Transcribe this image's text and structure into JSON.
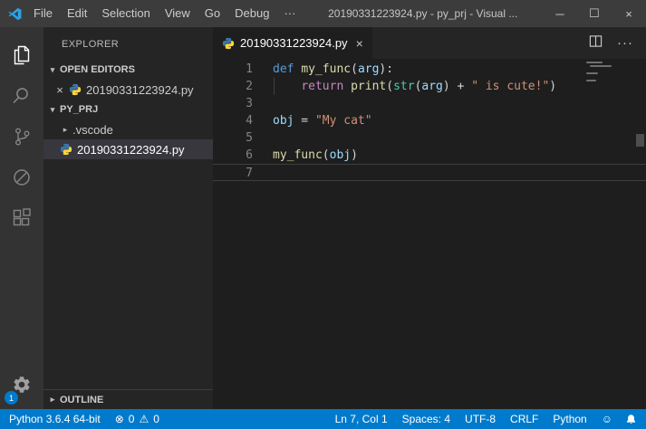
{
  "glyphs": {
    "close": "×",
    "more": "···",
    "chevron_down": "▾",
    "chevron_right": "▸",
    "minimize": "─",
    "maximize": "☐",
    "error": "⊗",
    "warning": "⚠",
    "smiley": "☺"
  },
  "colors": {
    "accent": "#007acc",
    "titlebar": "#3c3c3c",
    "activitybar": "#333333",
    "sidebar": "#252526",
    "editor_background": "#1e1e1e",
    "statusbar": "#007acc",
    "selected_row": "#37373d"
  },
  "title_bar": {
    "menus": [
      "File",
      "Edit",
      "Selection",
      "View",
      "Go",
      "Debug",
      "···"
    ],
    "window_title": "20190331223924.py - py_prj - Visual ..."
  },
  "activity_bar": {
    "settings_badge": "1"
  },
  "sidebar": {
    "title": "EXPLORER",
    "open_editors": {
      "label": "OPEN EDITORS",
      "items": [
        {
          "name": "20190331223924.py"
        }
      ]
    },
    "project": {
      "label": "PY_PRJ",
      "items": [
        {
          "name": ".vscode"
        },
        {
          "name": "20190331223924.py"
        }
      ]
    },
    "outline": {
      "label": "OUTLINE"
    }
  },
  "editor": {
    "tab": {
      "label": "20190331223924.py"
    },
    "code_lines": [
      {
        "num": "1",
        "tokens": [
          {
            "t": "def ",
            "c": "kw"
          },
          {
            "t": "my_func",
            "c": "fn"
          },
          {
            "t": "(",
            "c": "plain"
          },
          {
            "t": "arg",
            "c": "param"
          },
          {
            "t": "):",
            "c": "plain"
          }
        ]
      },
      {
        "num": "2",
        "tokens": [
          {
            "t": "    ",
            "c": "plain"
          },
          {
            "t": "return ",
            "c": "ctrl"
          },
          {
            "t": "print",
            "c": "fn"
          },
          {
            "t": "(",
            "c": "plain"
          },
          {
            "t": "str",
            "c": "type"
          },
          {
            "t": "(",
            "c": "plain"
          },
          {
            "t": "arg",
            "c": "param"
          },
          {
            "t": ") + ",
            "c": "plain"
          },
          {
            "t": "\" is cute!\"",
            "c": "str"
          },
          {
            "t": ")",
            "c": "plain"
          }
        ]
      },
      {
        "num": "3",
        "tokens": []
      },
      {
        "num": "4",
        "tokens": [
          {
            "t": "obj",
            "c": "param"
          },
          {
            "t": " = ",
            "c": "plain"
          },
          {
            "t": "\"My cat\"",
            "c": "str"
          }
        ]
      },
      {
        "num": "5",
        "tokens": []
      },
      {
        "num": "6",
        "tokens": [
          {
            "t": "my_func",
            "c": "fn"
          },
          {
            "t": "(",
            "c": "plain"
          },
          {
            "t": "obj",
            "c": "param"
          },
          {
            "t": ")",
            "c": "plain"
          }
        ]
      },
      {
        "num": "7",
        "tokens": [],
        "current": true
      }
    ]
  },
  "status_bar": {
    "interpreter": "Python 3.6.4 64-bit",
    "errors": "0",
    "warnings": "0",
    "cursor_position": "Ln 7, Col 1",
    "indentation": "Spaces: 4",
    "encoding": "UTF-8",
    "eol": "CRLF",
    "language": "Python"
  }
}
